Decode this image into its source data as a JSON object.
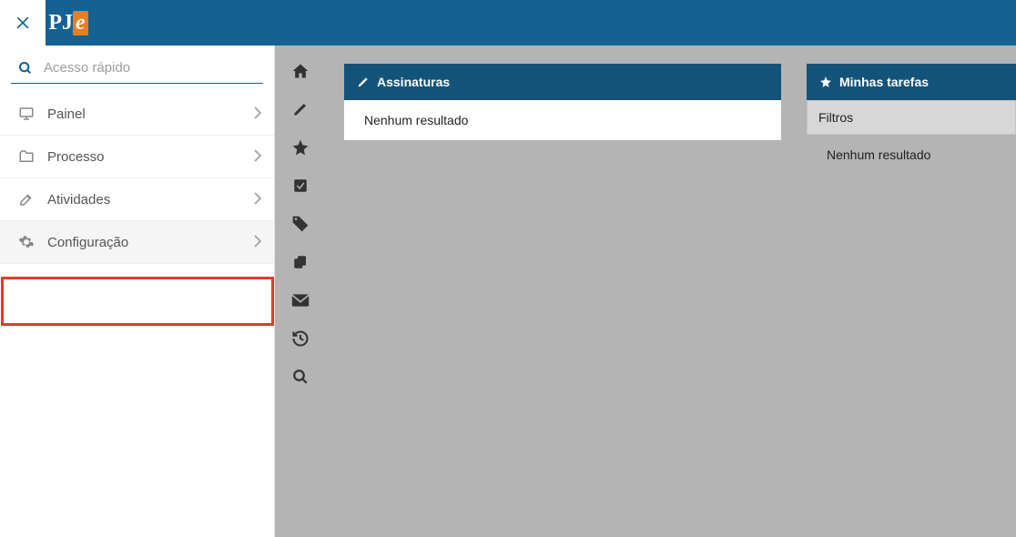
{
  "topbar": {
    "close_label": "×",
    "logo_p": "P",
    "logo_j": "J",
    "logo_e": "e"
  },
  "sidebar": {
    "search_placeholder": "Acesso rápido",
    "items": [
      {
        "label": "Painel"
      },
      {
        "label": "Processo"
      },
      {
        "label": "Atividades"
      },
      {
        "label": "Configuração"
      }
    ]
  },
  "panels": {
    "signatures": {
      "title": "Assinaturas",
      "empty": "Nenhum resultado"
    },
    "tasks": {
      "title": "Minhas tarefas",
      "filters_label": "Filtros",
      "empty": "Nenhum resultado"
    }
  }
}
